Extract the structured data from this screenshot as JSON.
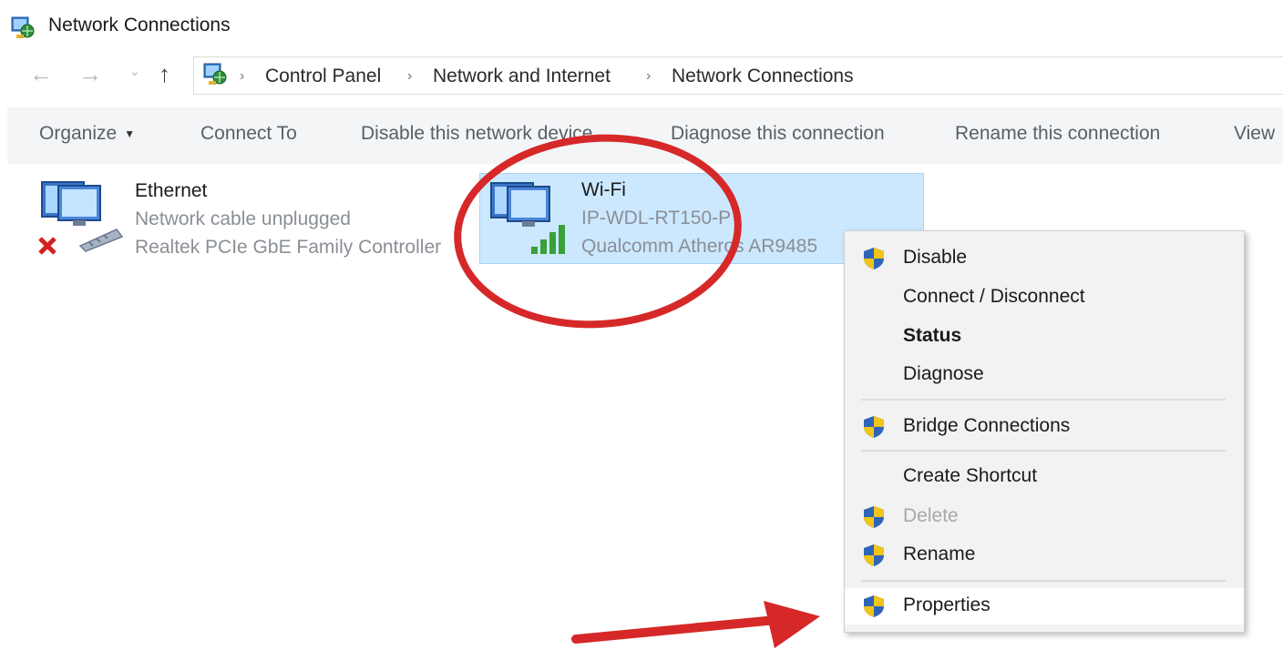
{
  "window": {
    "title": "Network Connections",
    "icon": "network-connections-icon"
  },
  "navigation": {
    "back_glyph": "←",
    "forward_glyph": "→",
    "recent_glyph": "⌄",
    "up_glyph": "↑",
    "breadcrumb": [
      "Control Panel",
      "Network and Internet",
      "Network Connections"
    ],
    "separator": "›"
  },
  "commandbar": {
    "organize": "Organize",
    "connect_to": "Connect To",
    "disable": "Disable this network device",
    "diagnose": "Diagnose this connection",
    "rename": "Rename this connection",
    "view": "View"
  },
  "connections": [
    {
      "name": "Ethernet",
      "status": "Network cable unplugged",
      "device": "Realtek PCIe GbE Family Controller",
      "icon": "ethernet-adapter-icon",
      "state": "disconnected"
    },
    {
      "name": "Wi-Fi",
      "status": "IP-WDL-RT150-P",
      "device": "Qualcomm Atheros AR9485",
      "icon": "wifi-adapter-icon",
      "state": "connected",
      "selected": true
    }
  ],
  "context_menu": {
    "items": [
      {
        "label": "Disable",
        "shield": true,
        "bold": false,
        "disabled": false
      },
      {
        "label": "Connect / Disconnect",
        "shield": false,
        "bold": false,
        "disabled": false
      },
      {
        "label": "Status",
        "shield": false,
        "bold": true,
        "disabled": false
      },
      {
        "label": "Diagnose",
        "shield": false,
        "bold": false,
        "disabled": false
      },
      {
        "label": "Bridge Connections",
        "shield": true,
        "bold": false,
        "disabled": false
      },
      {
        "label": "Create Shortcut",
        "shield": false,
        "bold": false,
        "disabled": false
      },
      {
        "label": "Delete",
        "shield": true,
        "bold": false,
        "disabled": true
      },
      {
        "label": "Rename",
        "shield": true,
        "bold": false,
        "disabled": false
      },
      {
        "label": "Properties",
        "shield": true,
        "bold": false,
        "disabled": false,
        "highlighted": true
      }
    ]
  },
  "colors": {
    "selection_bg": "#cce8ff",
    "annotation_red": "#d62828",
    "menu_bg": "#f2f2f2"
  }
}
